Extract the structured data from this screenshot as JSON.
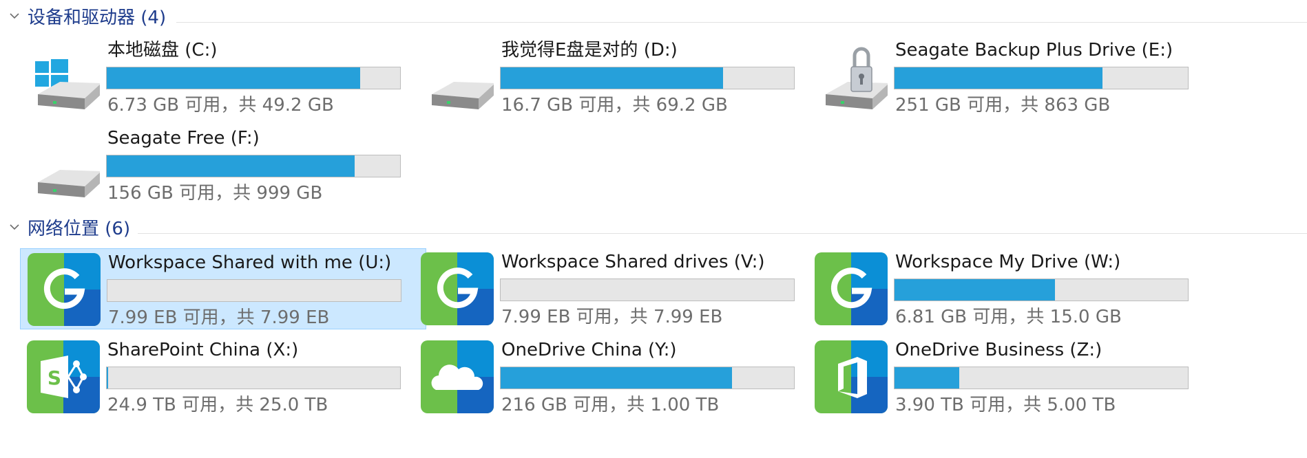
{
  "groups": [
    {
      "title": "设备和驱动器 (4)",
      "drives": [
        {
          "name": "本地磁盘 (C:)",
          "size": "6.73 GB 可用，共 49.2 GB",
          "used_fraction": 0.863,
          "icon": "windows-disk-icon",
          "selected": false
        },
        {
          "name": "我觉得E盘是对的 (D:)",
          "size": "16.7 GB 可用，共 69.2 GB",
          "used_fraction": 0.759,
          "icon": "hard-disk-icon",
          "selected": false
        },
        {
          "name": "Seagate Backup Plus Drive (E:)",
          "size": "251 GB 可用，共 863 GB",
          "used_fraction": 0.709,
          "icon": "locked-disk-icon",
          "selected": false
        },
        {
          "name": "Seagate Free (F:)",
          "size": "156 GB 可用，共 999 GB",
          "used_fraction": 0.844,
          "icon": "hard-disk-icon",
          "selected": false
        }
      ]
    },
    {
      "title": "网络位置 (6)",
      "drives": [
        {
          "name": "Workspace Shared with me (U:)",
          "size": "7.99 EB 可用，共 7.99 EB",
          "used_fraction": 0.0,
          "icon": "google-workspace-icon",
          "selected": true
        },
        {
          "name": "Workspace Shared drives (V:)",
          "size": "7.99 EB 可用，共 7.99 EB",
          "used_fraction": 0.0,
          "icon": "google-workspace-icon",
          "selected": false
        },
        {
          "name": "Workspace My Drive (W:)",
          "size": "6.81 GB 可用，共 15.0 GB",
          "used_fraction": 0.546,
          "icon": "google-workspace-icon",
          "selected": false
        },
        {
          "name": "SharePoint China (X:)",
          "size": "24.9 TB 可用，共 25.0 TB",
          "used_fraction": 0.004,
          "icon": "sharepoint-icon",
          "selected": false
        },
        {
          "name": "OneDrive China (Y:)",
          "size": "216 GB 可用，共 1.00 TB",
          "used_fraction": 0.789,
          "icon": "onedrive-cloud-icon",
          "selected": false
        },
        {
          "name": "OneDrive Business (Z:)",
          "size": "3.90 TB 可用，共 5.00 TB",
          "used_fraction": 0.22,
          "icon": "office-icon",
          "selected": false
        }
      ]
    }
  ],
  "colors": {
    "group_title": "#1e3c8c",
    "bar_fill": "#26a0da",
    "bar_bg": "#e6e6e6",
    "selection_bg": "#cce8ff",
    "selection_border": "#99d1ff",
    "size_text": "#6d6d6d",
    "tile_green": "#6cc04a",
    "tile_blue_light": "#0b8fd6",
    "tile_blue_dark": "#1565c0"
  }
}
